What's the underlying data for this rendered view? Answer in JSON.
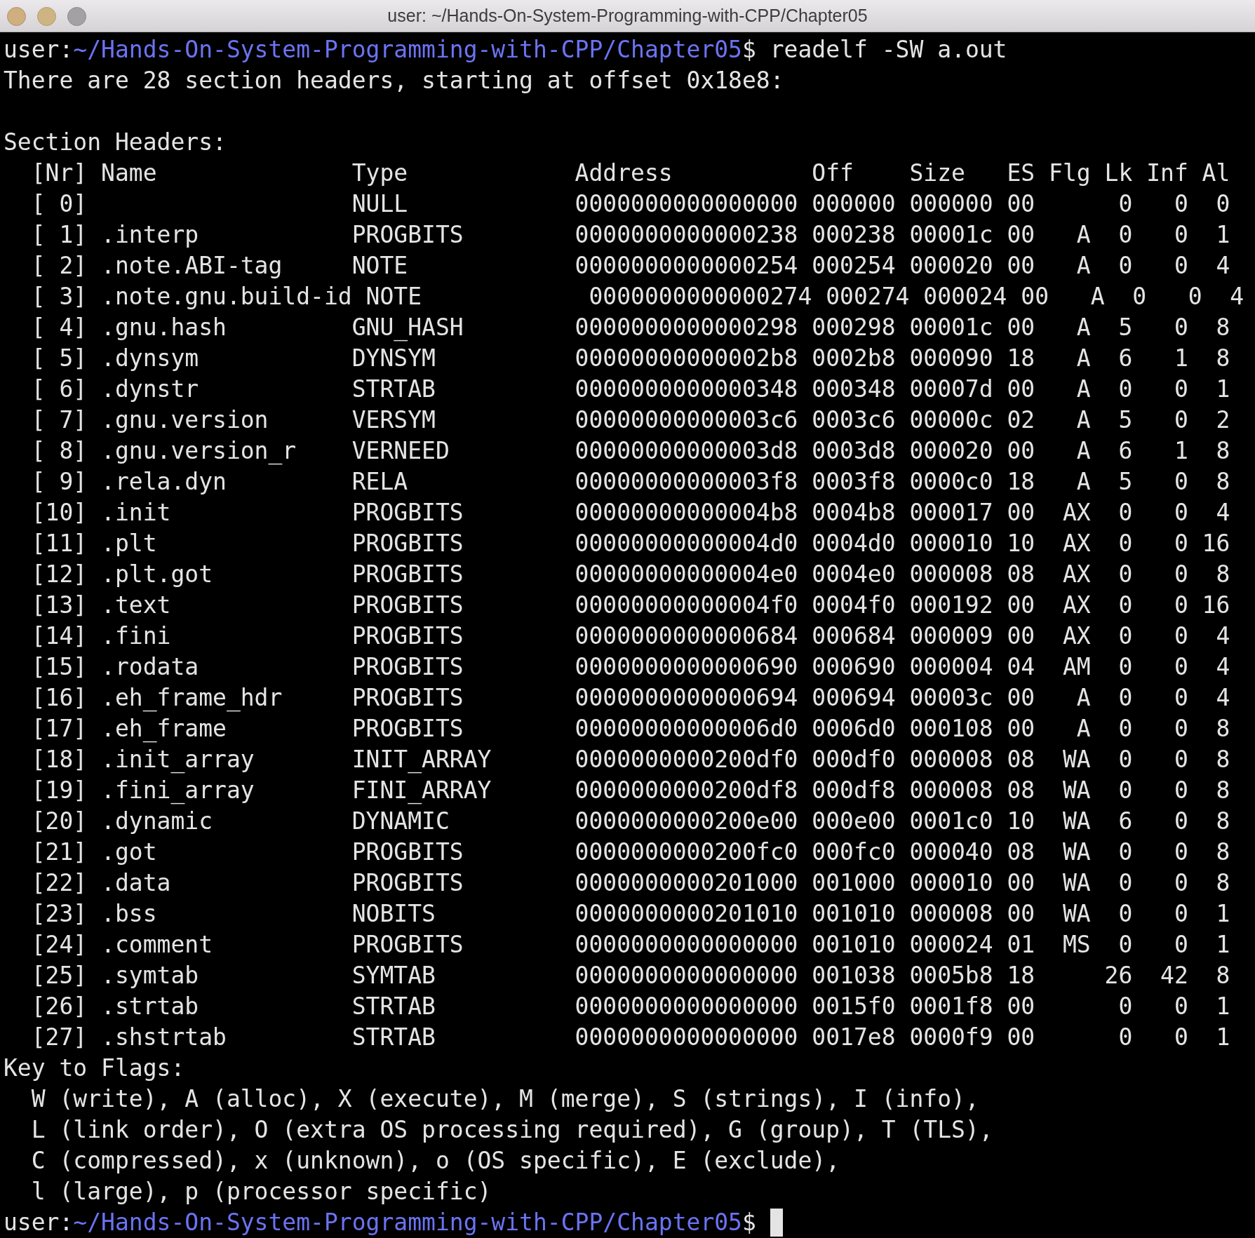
{
  "window": {
    "title": "user: ~/Hands-On-System-Programming-with-CPP/Chapter05"
  },
  "terminal": {
    "command": {
      "user": "user:",
      "path": "~/Hands-On-System-Programming-with-CPP/Chapter05",
      "symbol": "$",
      "text": "readelf -SW a.out"
    },
    "summary": "There are 28 section headers, starting at offset 0x18e8:",
    "section_title": "Section Headers:",
    "table_header": "[Nr] Name              Type            Address          Off    Size   ES Flg Lk Inf Al",
    "table_rows": [
      "[ 0]                   NULL            0000000000000000 000000 000000 00      0   0  0",
      "[ 1] .interp           PROGBITS        0000000000000238 000238 00001c 00   A  0   0  1",
      "[ 2] .note.ABI-tag     NOTE            0000000000000254 000254 000020 00   A  0   0  4",
      "[ 3] .note.gnu.build-id NOTE            0000000000000274 000274 000024 00   A  0   0  4",
      "[ 4] .gnu.hash         GNU_HASH        0000000000000298 000298 00001c 00   A  5   0  8",
      "[ 5] .dynsym           DYNSYM          00000000000002b8 0002b8 000090 18   A  6   1  8",
      "[ 6] .dynstr           STRTAB          0000000000000348 000348 00007d 00   A  0   0  1",
      "[ 7] .gnu.version      VERSYM          00000000000003c6 0003c6 00000c 02   A  5   0  2",
      "[ 8] .gnu.version_r    VERNEED         00000000000003d8 0003d8 000020 00   A  6   1  8",
      "[ 9] .rela.dyn         RELA            00000000000003f8 0003f8 0000c0 18   A  5   0  8",
      "[10] .init             PROGBITS        00000000000004b8 0004b8 000017 00  AX  0   0  4",
      "[11] .plt              PROGBITS        00000000000004d0 0004d0 000010 10  AX  0   0 16",
      "[12] .plt.got          PROGBITS        00000000000004e0 0004e0 000008 08  AX  0   0  8",
      "[13] .text             PROGBITS        00000000000004f0 0004f0 000192 00  AX  0   0 16",
      "[14] .fini             PROGBITS        0000000000000684 000684 000009 00  AX  0   0  4",
      "[15] .rodata           PROGBITS        0000000000000690 000690 000004 04  AM  0   0  4",
      "[16] .eh_frame_hdr     PROGBITS        0000000000000694 000694 00003c 00   A  0   0  4",
      "[17] .eh_frame         PROGBITS        00000000000006d0 0006d0 000108 00   A  0   0  8",
      "[18] .init_array       INIT_ARRAY      0000000000200df0 000df0 000008 08  WA  0   0  8",
      "[19] .fini_array       FINI_ARRAY      0000000000200df8 000df8 000008 08  WA  0   0  8",
      "[20] .dynamic          DYNAMIC         0000000000200e00 000e00 0001c0 10  WA  6   0  8",
      "[21] .got              PROGBITS        0000000000200fc0 000fc0 000040 08  WA  0   0  8",
      "[22] .data             PROGBITS        0000000000201000 001000 000010 00  WA  0   0  8",
      "[23] .bss              NOBITS          0000000000201010 001010 000008 00  WA  0   0  1",
      "[24] .comment          PROGBITS        0000000000000000 001010 000024 01  MS  0   0  1",
      "[25] .symtab           SYMTAB          0000000000000000 001038 0005b8 18     26  42  8",
      "[26] .strtab           STRTAB          0000000000000000 0015f0 0001f8 00      0   0  1",
      "[27] .shstrtab         STRTAB          0000000000000000 0017e8 0000f9 00      0   0  1"
    ],
    "flags_title": "Key to Flags:",
    "flags_lines": [
      "W (write), A (alloc), X (execute), M (merge), S (strings), I (info),",
      "L (link order), O (extra OS processing required), G (group), T (TLS),",
      "C (compressed), x (unknown), o (OS specific), E (exclude),",
      "l (large), p (processor specific)"
    ],
    "prompt": {
      "user": "user:",
      "path": "~/Hands-On-System-Programming-with-CPP/Chapter05",
      "symbol": "$",
      "cursor": true
    }
  }
}
